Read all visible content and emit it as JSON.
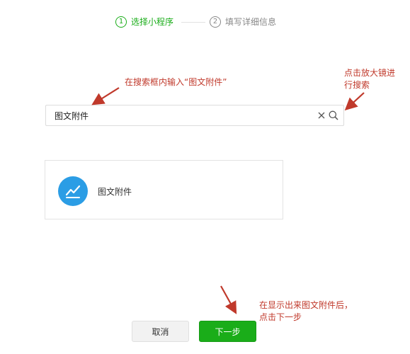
{
  "steps": [
    {
      "num": "1",
      "label": "选择小程序",
      "state": "active"
    },
    {
      "num": "2",
      "label": "填写详细信息",
      "state": "inactive"
    }
  ],
  "search": {
    "value": "图文附件"
  },
  "result": {
    "name": "图文附件",
    "icon": "pen-check-icon"
  },
  "annotations": {
    "search_hint": "在搜索框内输入“图文附件”",
    "magnifier_hint_line1": "点击放大镜进",
    "magnifier_hint_line2": "行搜索",
    "next_hint_line1": "在显示出来图文附件后，",
    "next_hint_line2": "点击下一步"
  },
  "buttons": {
    "cancel": "取消",
    "next": "下一步"
  },
  "colors": {
    "accent": "#1aad19",
    "annotation": "#c0392b",
    "app_icon_bg": "#2b9de5"
  }
}
